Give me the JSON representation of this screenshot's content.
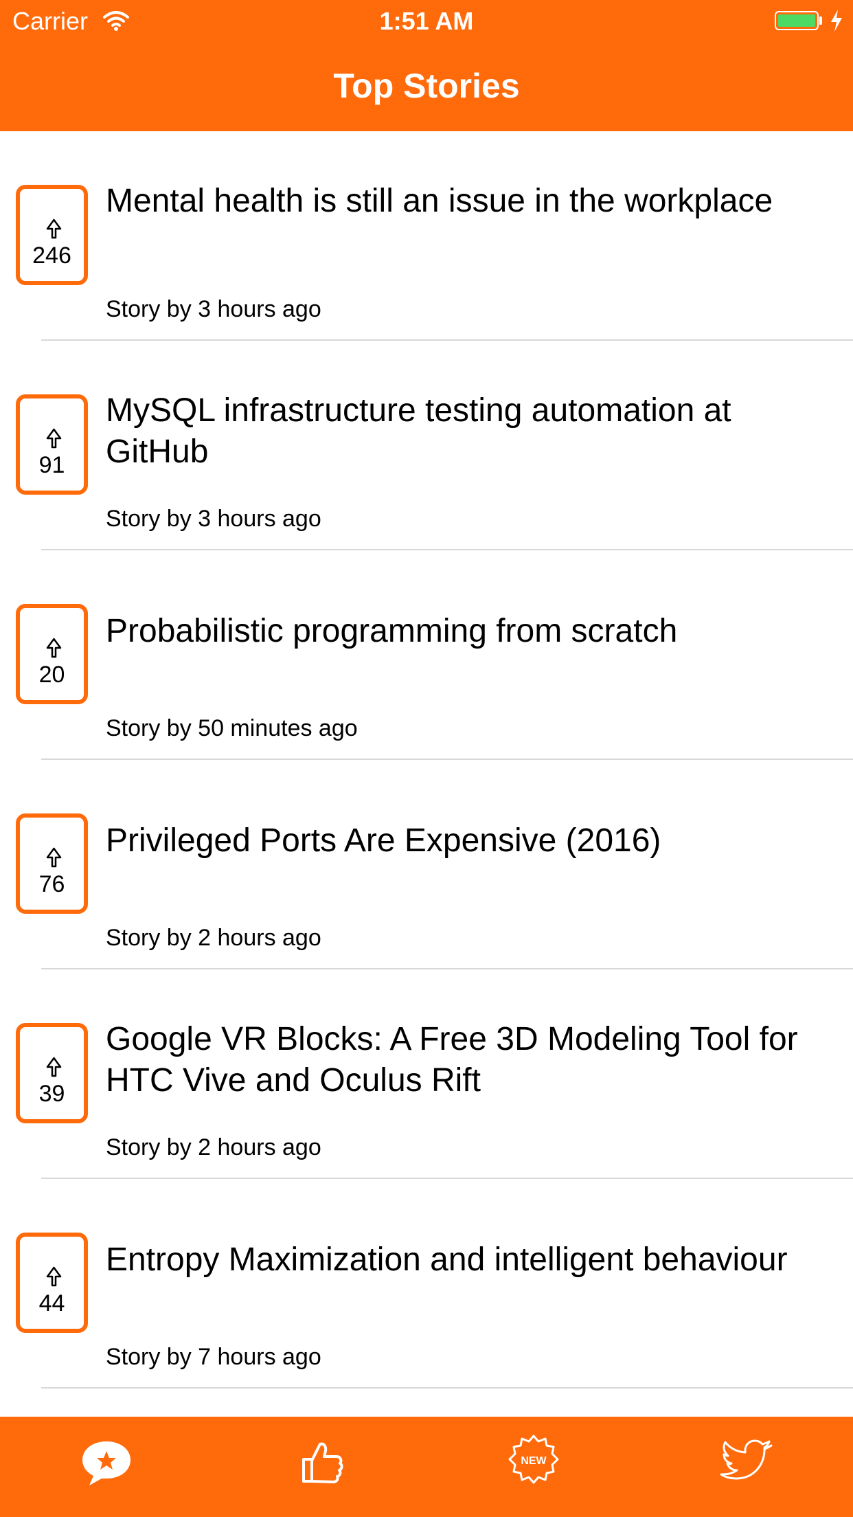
{
  "status_bar": {
    "carrier": "Carrier",
    "time": "1:51 AM"
  },
  "nav": {
    "title": "Top Stories"
  },
  "colors": {
    "accent": "#FF6A0B",
    "battery": "#4CD964",
    "separator": "#D8D8D8"
  },
  "stories": [
    {
      "title": "Mental health is still an issue in the workplace",
      "votes": "246",
      "meta": "Story by 3 hours ago"
    },
    {
      "title": "MySQL infrastructure testing automation at GitHub",
      "votes": "91",
      "meta": "Story by 3 hours ago"
    },
    {
      "title": "Probabilistic programming from scratch",
      "votes": "20",
      "meta": "Story by 50 minutes ago"
    },
    {
      "title": "Privileged Ports Are Expensive (2016)",
      "votes": "76",
      "meta": "Story by 2 hours ago"
    },
    {
      "title": "Google VR Blocks: A Free 3D Modeling Tool for HTC Vive and Oculus Rift",
      "votes": "39",
      "meta": "Story by 2 hours ago"
    },
    {
      "title": "Entropy Maximization and intelligent behaviour",
      "votes": "44",
      "meta": "Story by 7 hours ago"
    }
  ],
  "tabbar": {
    "tabs": [
      {
        "icon": "star-chat-bubble-icon"
      },
      {
        "icon": "thumbs-up-icon"
      },
      {
        "icon": "new-badge-icon",
        "badge_text": "NEW"
      },
      {
        "icon": "twitter-bird-icon"
      }
    ]
  }
}
